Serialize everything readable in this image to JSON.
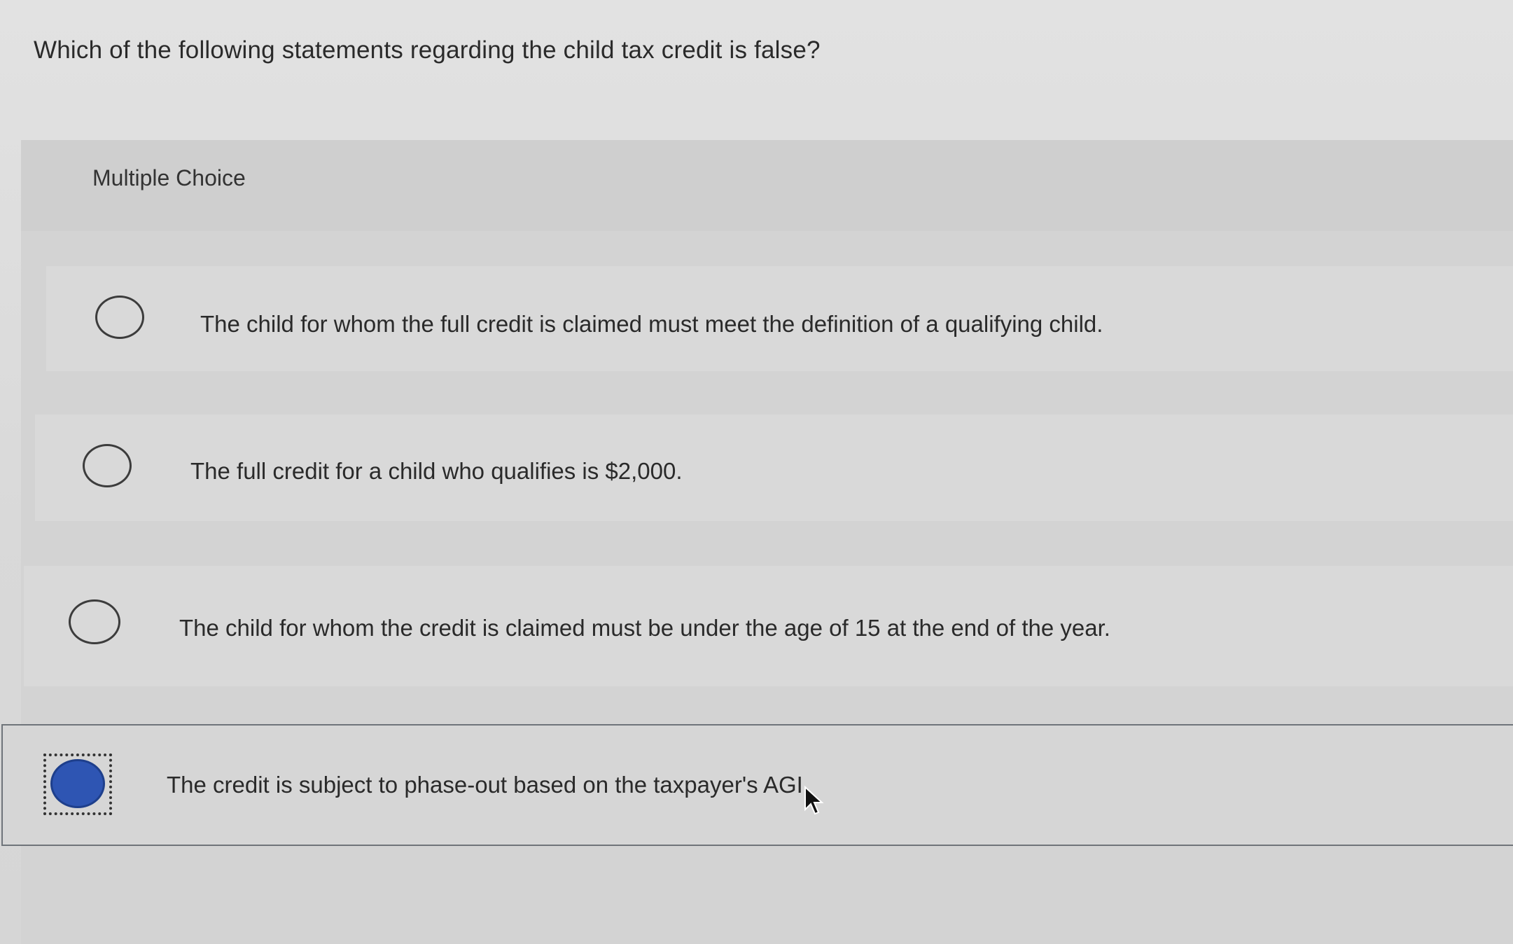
{
  "question": {
    "text": "Which of the following statements regarding the child tax credit is false?"
  },
  "multiple_choice": {
    "label": "Multiple Choice",
    "options": [
      {
        "text": "The child for whom the full credit is claimed must meet the definition of a qualifying child.",
        "selected": false
      },
      {
        "text": "The full credit for a child who qualifies is $2,000.",
        "selected": false
      },
      {
        "text": "The child for whom the credit is claimed must be under the age of 15 at the end of the year.",
        "selected": false
      },
      {
        "text": "The credit is subject to phase-out based on the taxpayer's AGI.",
        "selected": true
      }
    ]
  },
  "colors": {
    "selected_radio": "#2e55b3",
    "selected_border": "#6f747a"
  },
  "icons": {
    "cursor": "mouse-pointer-icon"
  }
}
